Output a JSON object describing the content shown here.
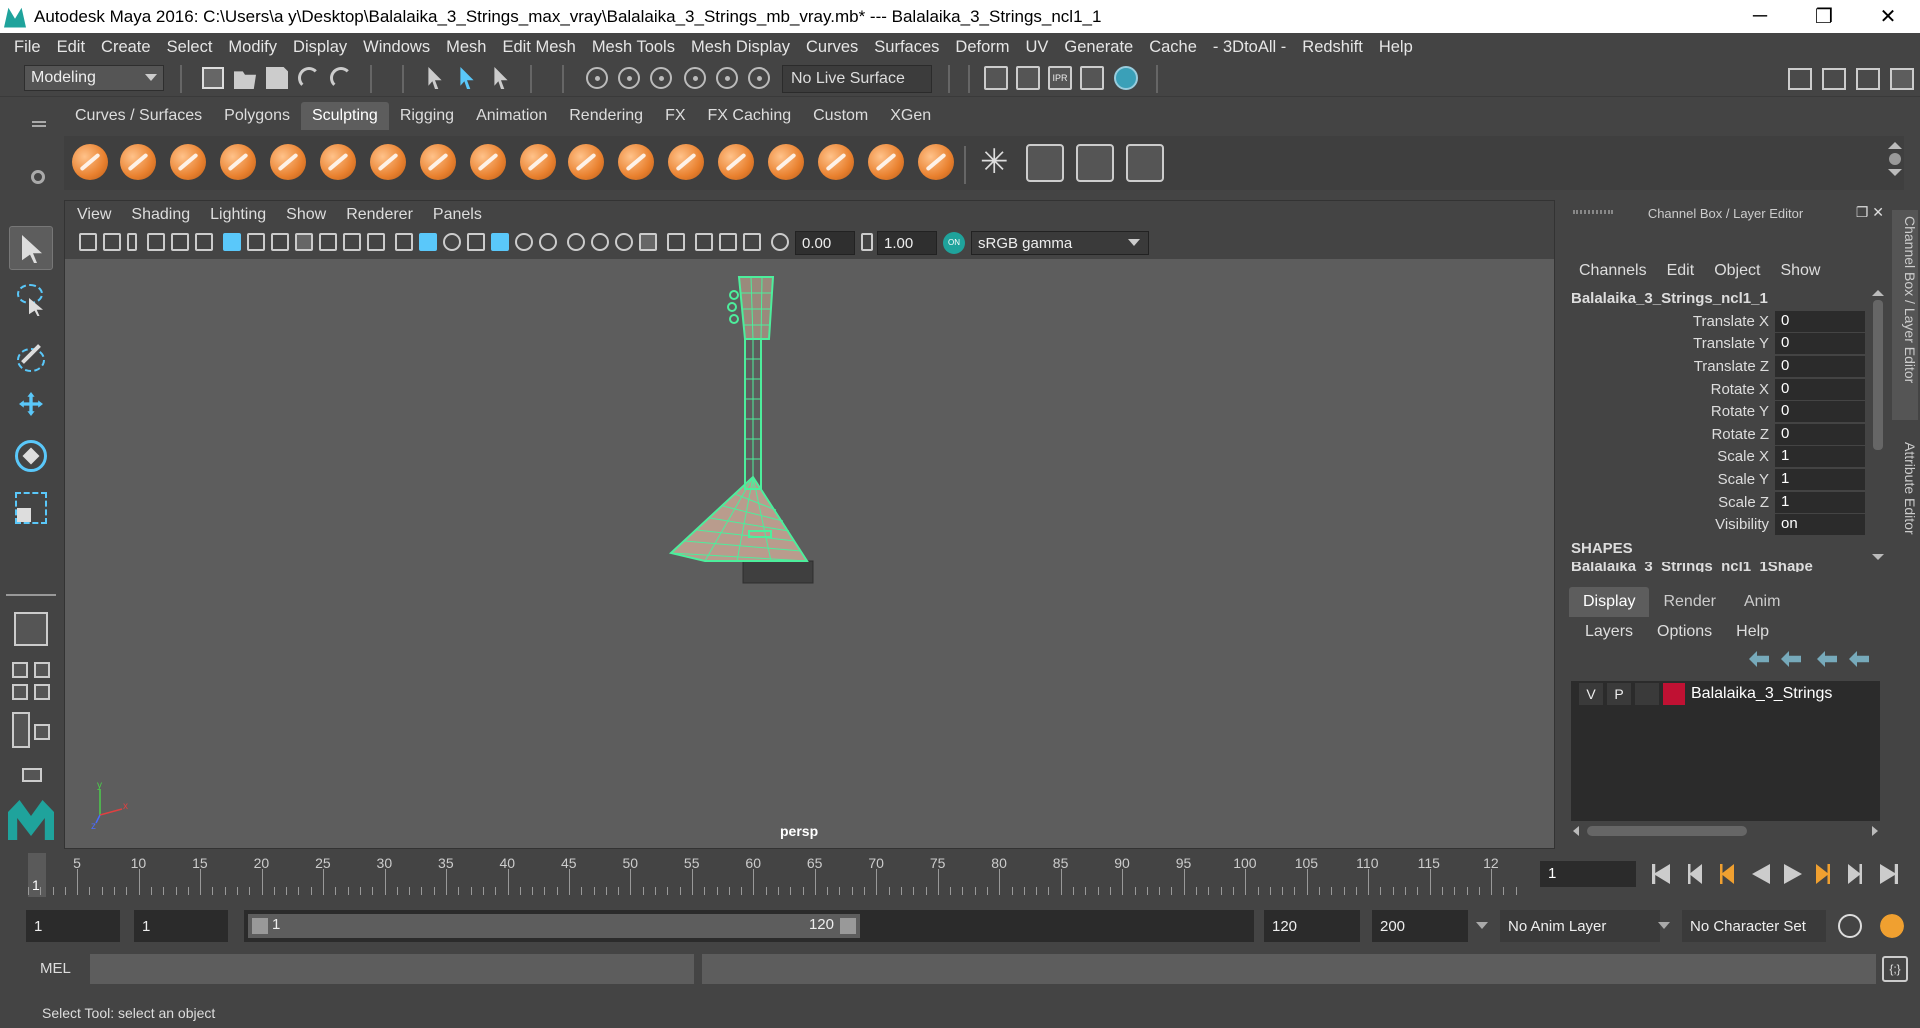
{
  "window": {
    "title": "Autodesk Maya 2016: C:\\Users\\a y\\Desktop\\Balalaika_3_Strings_max_vray\\Balalaika_3_Strings_mb_vray.mb*   ---   Balalaika_3_Strings_ncl1_1",
    "minimize": "─",
    "maximize": "❐",
    "close": "✕"
  },
  "menubar": [
    "File",
    "Edit",
    "Create",
    "Select",
    "Modify",
    "Display",
    "Windows",
    "Mesh",
    "Edit Mesh",
    "Mesh Tools",
    "Mesh Display",
    "Curves",
    "Surfaces",
    "Deform",
    "UV",
    "Generate",
    "Cache",
    "- 3DtoAll -",
    "Redshift",
    "Help"
  ],
  "statusline": {
    "mode": "Modeling",
    "live_surface": "No Live Surface"
  },
  "shelf": {
    "tabs": [
      "Curves / Surfaces",
      "Polygons",
      "Sculpting",
      "Rigging",
      "Animation",
      "Rendering",
      "FX",
      "FX Caching",
      "Custom",
      "XGen"
    ],
    "active_tab": "Sculpting"
  },
  "viewport": {
    "menu": [
      "View",
      "Shading",
      "Lighting",
      "Show",
      "Renderer",
      "Panels"
    ],
    "exposure": "0.00",
    "gamma": "1.00",
    "color_management": "sRGB gamma",
    "color_mgmt_badge": "ON",
    "camera": "persp",
    "axis": {
      "x": "x",
      "y": "y",
      "z": "z"
    },
    "model_colors": {
      "wire": "#4dee9c",
      "fill": "#c9a795"
    }
  },
  "channel_box": {
    "header": "Channel Box / Layer Editor",
    "menu": [
      "Channels",
      "Edit",
      "Object",
      "Show"
    ],
    "object": "Balalaika_3_Strings_ncl1_1",
    "channels": [
      {
        "label": "Translate X",
        "value": "0"
      },
      {
        "label": "Translate Y",
        "value": "0"
      },
      {
        "label": "Translate Z",
        "value": "0"
      },
      {
        "label": "Rotate X",
        "value": "0"
      },
      {
        "label": "Rotate Y",
        "value": "0"
      },
      {
        "label": "Rotate Z",
        "value": "0"
      },
      {
        "label": "Scale X",
        "value": "1"
      },
      {
        "label": "Scale Y",
        "value": "1"
      },
      {
        "label": "Scale Z",
        "value": "1"
      },
      {
        "label": "Visibility",
        "value": "on"
      }
    ],
    "shapes_label": "SHAPES",
    "shape_name": "Balalaika_3_Strings_ncl1_1Shape"
  },
  "side_tabs": [
    "Channel Box / Layer Editor",
    "Attribute Editor"
  ],
  "layer_editor": {
    "tabs": [
      "Display",
      "Render",
      "Anim"
    ],
    "menu": [
      "Layers",
      "Options",
      "Help"
    ],
    "layer": {
      "v": "V",
      "p": "P",
      "name": "Balalaika_3_Strings",
      "color": "#c01133"
    }
  },
  "timeslider": {
    "ticks": [
      "5",
      "10",
      "15",
      "20",
      "25",
      "30",
      "35",
      "40",
      "45",
      "50",
      "55",
      "60",
      "65",
      "70",
      "75",
      "80",
      "85",
      "90",
      "95",
      "100",
      "105",
      "110",
      "115",
      "12"
    ],
    "current_frame": "1",
    "frame_field": "1"
  },
  "rangebar": {
    "start": "1",
    "anim_start": "1",
    "range_start": "1",
    "range_end": "120",
    "end": "120",
    "anim_end": "200",
    "anim_layer": "No Anim Layer",
    "char_set": "No Character Set"
  },
  "cmdline": {
    "label": "MEL",
    "script_icon": "{;}"
  },
  "help": "Select Tool: select an object"
}
